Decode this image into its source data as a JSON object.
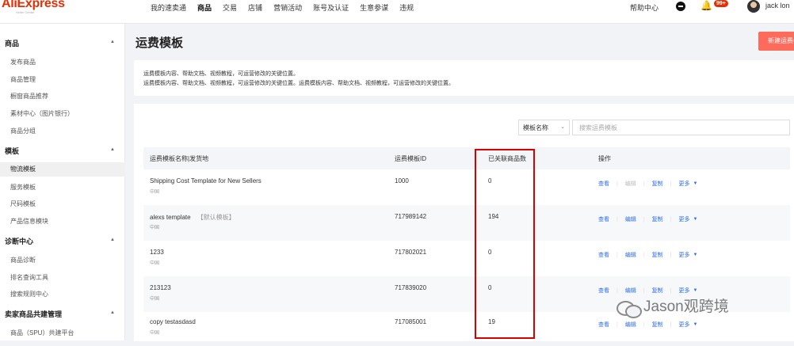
{
  "app": {
    "logo": "AliExpress",
    "logo_sub": "Seller Center"
  },
  "topnav": {
    "items": [
      "我的速卖通",
      "商品",
      "交易",
      "店铺",
      "营销活动",
      "账号及认证",
      "生意参谋",
      "违规"
    ],
    "active_index": 1
  },
  "header_right": {
    "help": "帮助中心",
    "badge": "99+",
    "user": "jack lon"
  },
  "sidebar": {
    "sections": [
      {
        "title": "商品",
        "items": [
          "发布商品",
          "商品管理",
          "橱窗商品推荐",
          "素材中心（图片银行）",
          "商品分组"
        ]
      },
      {
        "title": "模板",
        "items": [
          "物流模板",
          "服务模板",
          "尺码模板",
          "产品信息模块"
        ],
        "active_item": "物流模板"
      },
      {
        "title": "诊断中心",
        "items": [
          "商品诊断",
          "排名查询工具",
          "搜索规则中心"
        ]
      },
      {
        "title": "卖家商品共建管理",
        "items": [
          "商品（SPU）共建平台"
        ]
      }
    ]
  },
  "page": {
    "title": "运费模板",
    "new_button": "新建运费模板",
    "notice_lines": [
      "运费模板内容、帮助文档、视频教程，可运营修改的关键位置。",
      "运费模板内容、帮助文档、视频教程，可运营修改的关键位置。运费模板内容、帮助文档、视频教程，可运营修改的关键位置。"
    ]
  },
  "filter": {
    "select_value": "模板名称",
    "input_placeholder": "搜索运费模板"
  },
  "table": {
    "headers": [
      "运费模板名称|发货地",
      "运费模板ID",
      "已关联商品数",
      "操作"
    ],
    "rows": [
      {
        "name": "Shipping Cost Template for New Sellers",
        "tag": "",
        "origin": "中国",
        "id": "1000",
        "count": "0",
        "ops": [
          {
            "label": "查看",
            "disabled": false
          },
          {
            "label": "编辑",
            "disabled": true
          },
          {
            "label": "复制",
            "disabled": false
          },
          {
            "label": "更多",
            "disabled": false
          }
        ]
      },
      {
        "name": "alexs template",
        "tag": "【默认模板】",
        "origin": "中国",
        "id": "717989142",
        "count": "194",
        "ops": [
          {
            "label": "查看",
            "disabled": false
          },
          {
            "label": "编辑",
            "disabled": false
          },
          {
            "label": "复制",
            "disabled": false
          },
          {
            "label": "更多",
            "disabled": false
          }
        ]
      },
      {
        "name": "1233",
        "tag": "",
        "origin": "中国",
        "id": "717802021",
        "count": "0",
        "ops": [
          {
            "label": "查看",
            "disabled": false
          },
          {
            "label": "编辑",
            "disabled": false
          },
          {
            "label": "复制",
            "disabled": false
          },
          {
            "label": "更多",
            "disabled": false
          }
        ]
      },
      {
        "name": "213123",
        "tag": "",
        "origin": "中国",
        "id": "717839020",
        "count": "0",
        "ops": [
          {
            "label": "查看",
            "disabled": false
          },
          {
            "label": "编辑",
            "disabled": false
          },
          {
            "label": "复制",
            "disabled": false
          },
          {
            "label": "更多",
            "disabled": false
          }
        ]
      },
      {
        "name": "copy testasdasd",
        "tag": "",
        "origin": "中国",
        "id": "717085001",
        "count": "19",
        "ops": [
          {
            "label": "查看",
            "disabled": false
          },
          {
            "label": "编辑",
            "disabled": false
          },
          {
            "label": "复制",
            "disabled": false
          },
          {
            "label": "更多",
            "disabled": false
          }
        ]
      }
    ]
  },
  "watermark": "Jason观跨境",
  "colors": {
    "brand": "#e62e04",
    "link": "#2b6de5",
    "highlight": "#d90000",
    "primary_button": "#ff6b5b"
  }
}
